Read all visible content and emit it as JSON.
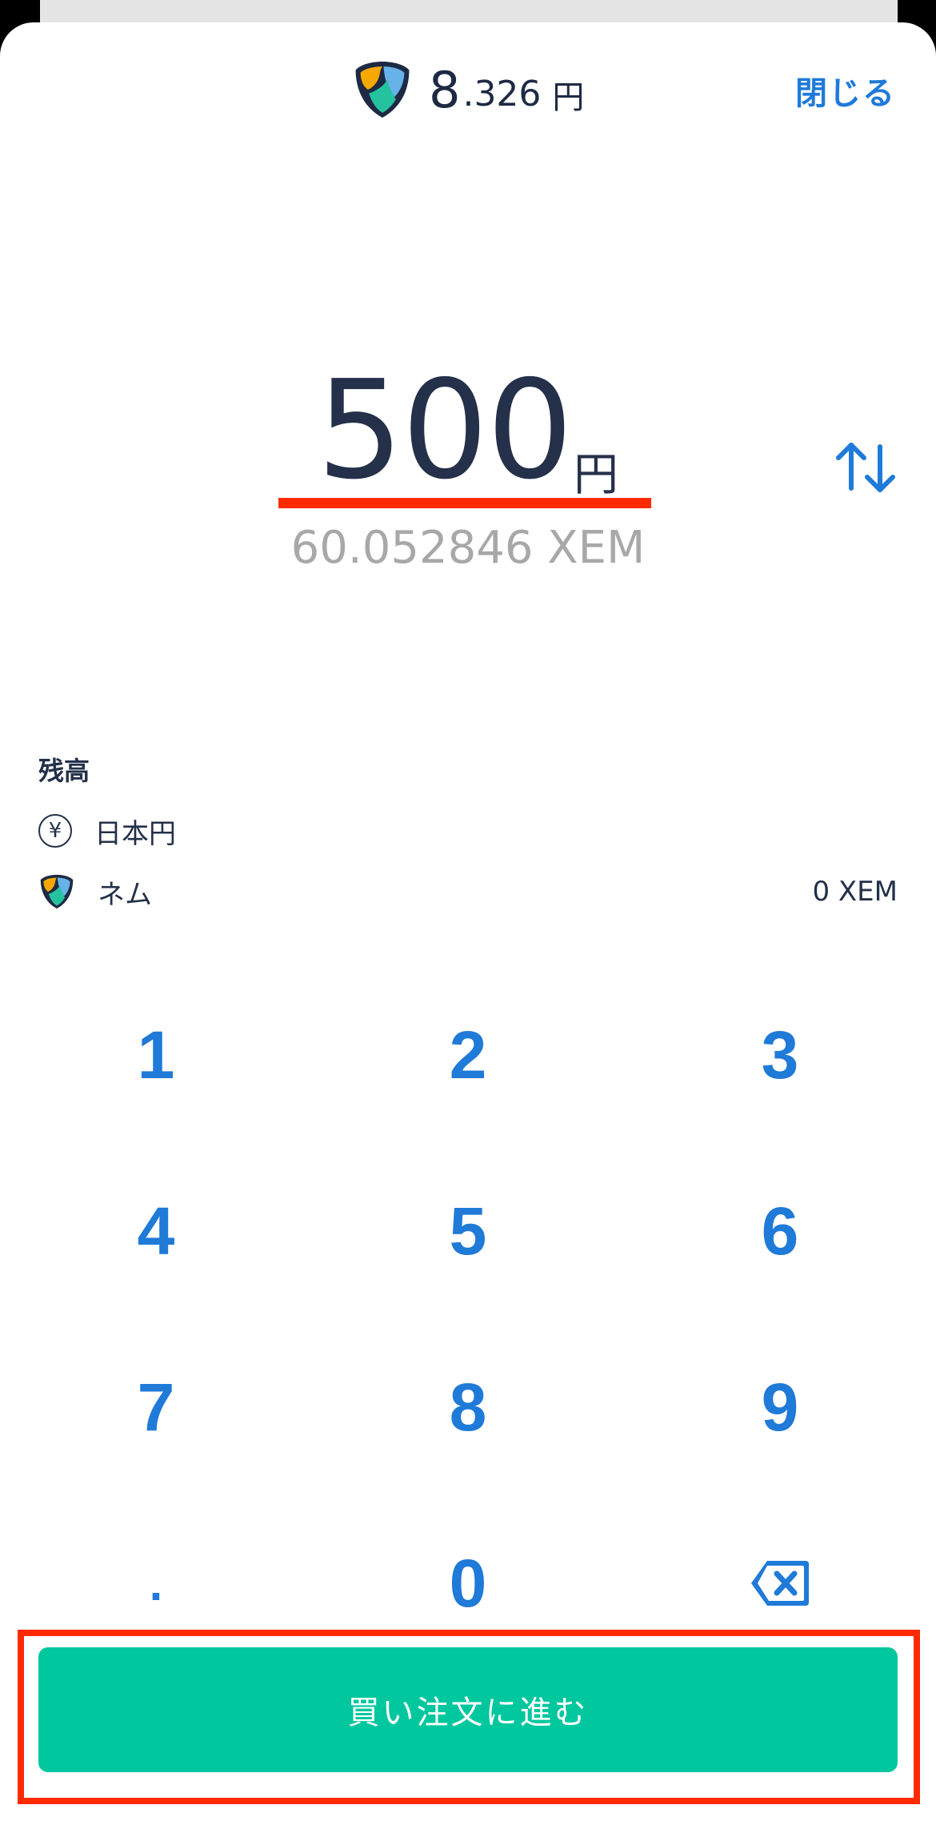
{
  "header": {
    "price_main": "8",
    "price_decimal": ".326",
    "price_unit": "円",
    "close_label": "閉じる"
  },
  "amount": {
    "value": "500",
    "unit": "円",
    "converted": "60.052846 XEM"
  },
  "balance": {
    "title": "残高",
    "jpy_label": "日本円",
    "jpy_symbol": "¥",
    "xem_label": "ネム",
    "xem_value": "0 XEM"
  },
  "keypad": {
    "keys": [
      "1",
      "2",
      "3",
      "4",
      "5",
      "6",
      "7",
      "8",
      "9",
      ".",
      "0"
    ],
    "backspace_icon": "backspace-icon"
  },
  "cta": {
    "label": "買い注文に進む"
  },
  "colors": {
    "accent_blue": "#1f7ad8",
    "cta_green": "#00c79e",
    "highlight_red": "#ff2a00",
    "text_dark": "#24304a",
    "muted_gray": "#a8a8a8"
  }
}
